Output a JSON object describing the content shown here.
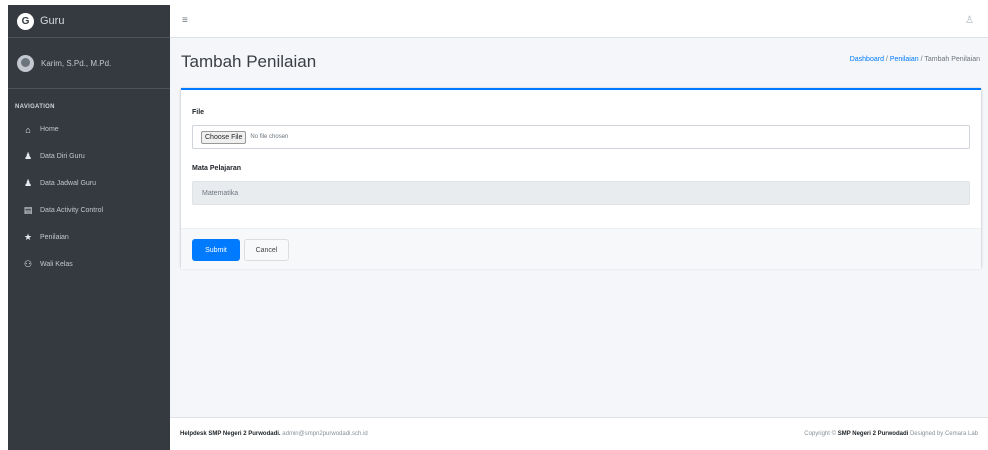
{
  "sidebar": {
    "brand": "Guru",
    "user_name": "Karim, S.Pd., M.Pd.",
    "nav_header": "NAVIGATION",
    "items": [
      {
        "icon": "home-icon",
        "label": "Home"
      },
      {
        "icon": "user-icon",
        "label": "Data Diri Guru"
      },
      {
        "icon": "user-icon",
        "label": "Data Jadwal Guru"
      },
      {
        "icon": "clipboard-icon",
        "label": "Data Activity Control"
      },
      {
        "icon": "star-icon",
        "label": "Penilaian"
      },
      {
        "icon": "users-icon",
        "label": "Wali Kelas"
      }
    ]
  },
  "page": {
    "title": "Tambah Penilaian",
    "breadcrumb": {
      "dashboard": "Dashboard",
      "penilaian": "Penilaian",
      "current": "Tambah Penilaian"
    }
  },
  "form": {
    "file_label": "File",
    "choose_file": "Choose File",
    "no_file": "No file chosen",
    "subject_label": "Mata Pelajaran",
    "subject_value": "Matematika",
    "submit_label": "Submit",
    "cancel_label": "Cancel"
  },
  "footer": {
    "left_bold": "Helpdesk SMP Negeri 2 Purwodadi.",
    "left_email": "admin@smpn2purwodadi.sch.id",
    "right_prefix": "Copyright ©",
    "right_bold": "SMP Negeri 2 Purwodadi",
    "right_suffix": "Designed by Cemara Lab"
  },
  "colors": {
    "sidebar_bg": "#343a40",
    "accent": "#007bff",
    "content_bg": "#f4f6f9"
  }
}
